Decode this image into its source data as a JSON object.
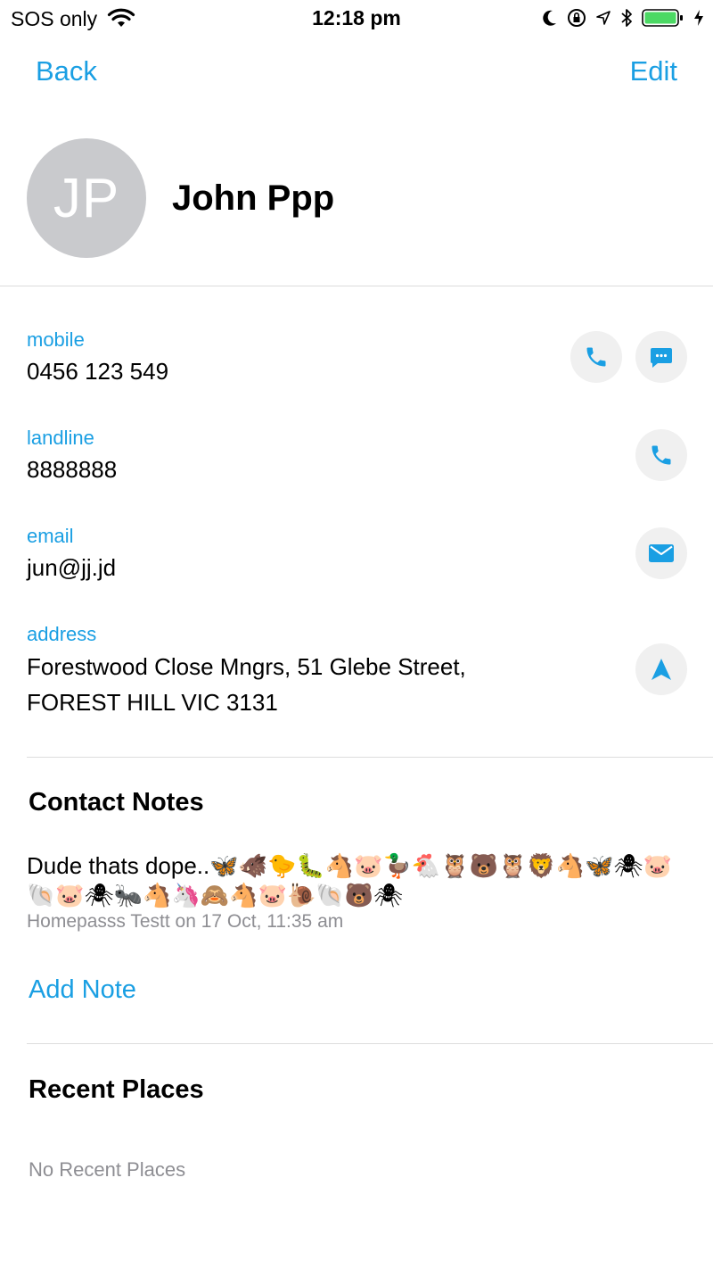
{
  "status_bar": {
    "carrier": "SOS only",
    "time": "12:18 pm",
    "battery_color": "#4cd964"
  },
  "nav": {
    "back_label": "Back",
    "edit_label": "Edit",
    "accent_color": "#1a9fe3"
  },
  "contact": {
    "initials": "JP",
    "name": "John Ppp"
  },
  "fields": {
    "mobile": {
      "label": "mobile",
      "value": "0456 123 549",
      "actions": [
        "phone-icon",
        "message-icon"
      ]
    },
    "landline": {
      "label": "landline",
      "value": "8888888",
      "actions": [
        "phone-icon"
      ]
    },
    "email": {
      "label": "email",
      "value": "jun@jj.jd",
      "actions": [
        "mail-icon"
      ]
    },
    "address": {
      "label": "address",
      "line1": "Forestwood Close Mngrs, 51 Glebe Street,",
      "line2": "FOREST HILL VIC 3131",
      "actions": [
        "navigation-arrow-icon"
      ]
    }
  },
  "notes": {
    "title": "Contact Notes",
    "items": [
      {
        "text": "Dude thats dope..🦋🐗🐤🐛🐴🐷🦆🐔🦉🐻🦉🦁🐴🦋🕷🐷🐚🐷🕷🐜🐴🦄🙈🐴🐷🐌🐚🐻🕷",
        "meta": "Homepasss Testt on 17 Oct, 11:35 am"
      }
    ],
    "add_label": "Add Note"
  },
  "recent_places": {
    "title": "Recent Places",
    "empty_text": "No Recent Places"
  }
}
